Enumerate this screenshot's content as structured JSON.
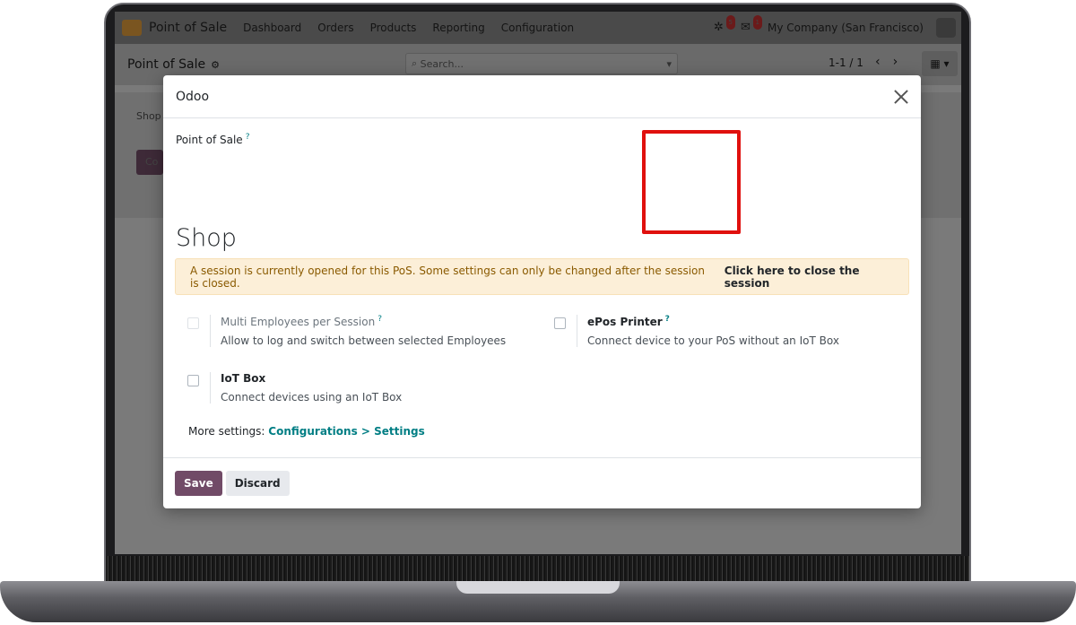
{
  "navbar": {
    "app_name": "Point of Sale",
    "items": [
      "Dashboard",
      "Orders",
      "Products",
      "Reporting",
      "Configuration"
    ],
    "activity_badge": "5",
    "messages_badge": "1",
    "company": "My Company (San Francisco)"
  },
  "control": {
    "title": "Point of Sale",
    "search_placeholder": "Search...",
    "pager": "1-1 / 1"
  },
  "background": {
    "label": "Shop",
    "button": "Co"
  },
  "modal": {
    "title": "Odoo",
    "field_label": "Point of Sale",
    "help_mark": "?",
    "section_title": "Shop",
    "alert_text": "A session is currently opened for this PoS. Some settings can only be changed after the session is closed.",
    "alert_link": "Click here to close the session",
    "settings": [
      {
        "name": "Multi Employees per Session",
        "desc": "Allow to log and switch between selected Employees",
        "has_help": true,
        "disabled": true
      },
      {
        "name": "ePos Printer",
        "desc": "Connect device to your PoS without an IoT Box",
        "has_help": true,
        "disabled": false
      },
      {
        "name": "IoT Box",
        "desc": "Connect devices using an IoT Box",
        "has_help": false,
        "disabled": false
      }
    ],
    "more_settings_label": "More settings:",
    "more_settings_link": "Configurations > Settings",
    "save_label": "Save",
    "discard_label": "Discard"
  },
  "colors": {
    "primary": "#714b67",
    "link": "#017e84",
    "alert_bg": "#fcefd8",
    "highlight": "#e0100e"
  }
}
